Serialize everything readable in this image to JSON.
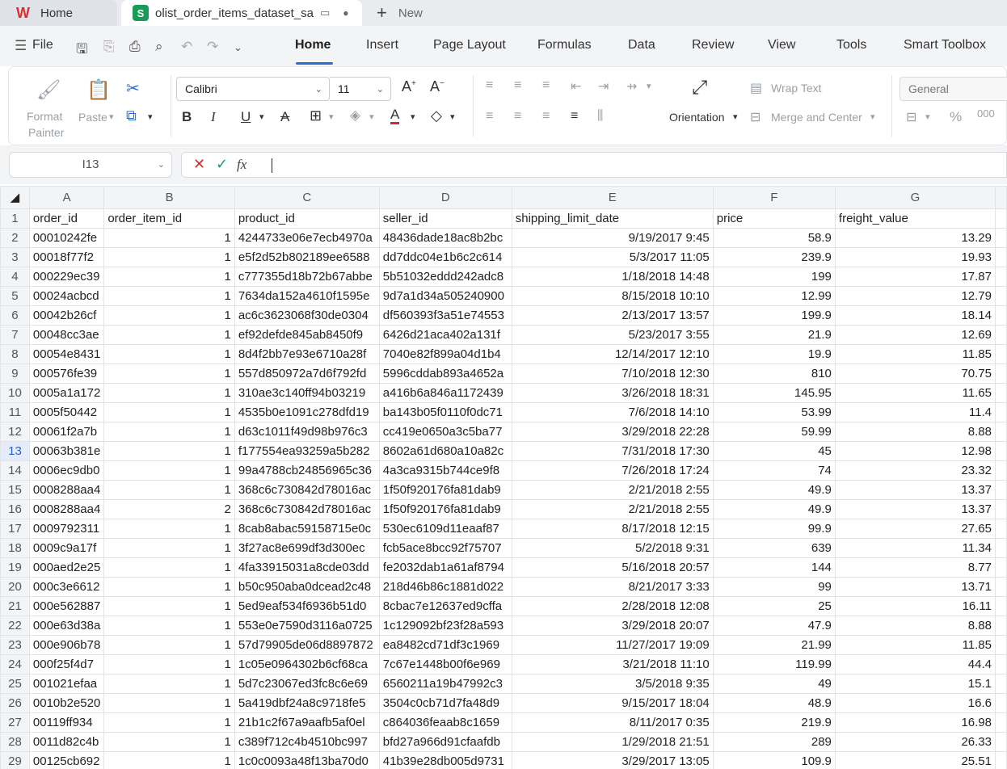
{
  "tabs": {
    "home_label": "Home",
    "file_title": "olist_order_items_dataset_sam",
    "new_label": "New"
  },
  "menu": {
    "file": "File",
    "items": [
      "Home",
      "Insert",
      "Page Layout",
      "Formulas",
      "Data",
      "Review",
      "View",
      "Tools",
      "Smart Toolbox"
    ]
  },
  "ribbon": {
    "format_painter_1": "Format",
    "format_painter_2": "Painter",
    "paste": "Paste",
    "font_name": "Calibri",
    "font_size": "11",
    "orientation": "Orientation",
    "wrap_text": "Wrap Text",
    "merge_center": "Merge and Center",
    "number_format": "General"
  },
  "formula_bar": {
    "name_box": "I13",
    "formula": ""
  },
  "sheet": {
    "columns": [
      "A",
      "B",
      "C",
      "D",
      "E",
      "F",
      "G"
    ],
    "selected_row": 13,
    "header_row": [
      "order_id",
      "order_item_id",
      "product_id",
      "seller_id",
      "shipping_limit_date",
      "price",
      "freight_value"
    ],
    "rows": [
      [
        "00010242fe",
        "1",
        "4244733e06e7ecb4970a",
        "48436dade18ac8b2bc",
        "9/19/2017 9:45",
        "58.9",
        "13.29"
      ],
      [
        "00018f77f2",
        "1",
        "e5f2d52b802189ee6588",
        "dd7ddc04e1b6c2c614",
        "5/3/2017 11:05",
        "239.9",
        "19.93"
      ],
      [
        "000229ec39",
        "1",
        "c777355d18b72b67abbe",
        "5b51032eddd242adc8",
        "1/18/2018 14:48",
        "199",
        "17.87"
      ],
      [
        "00024acbcd",
        "1",
        "7634da152a4610f1595e",
        "9d7a1d34a505240900",
        "8/15/2018 10:10",
        "12.99",
        "12.79"
      ],
      [
        "00042b26cf",
        "1",
        "ac6c3623068f30de0304",
        "df560393f3a51e74553",
        "2/13/2017 13:57",
        "199.9",
        "18.14"
      ],
      [
        "00048cc3ae",
        "1",
        "ef92defde845ab8450f9",
        "6426d21aca402a131f",
        "5/23/2017 3:55",
        "21.9",
        "12.69"
      ],
      [
        "00054e8431",
        "1",
        "8d4f2bb7e93e6710a28f",
        "7040e82f899a04d1b4",
        "12/14/2017 12:10",
        "19.9",
        "11.85"
      ],
      [
        "000576fe39",
        "1",
        "557d850972a7d6f792fd",
        "5996cddab893a4652a",
        "7/10/2018 12:30",
        "810",
        "70.75"
      ],
      [
        "0005a1a172",
        "1",
        "310ae3c140ff94b03219",
        "a416b6a846a1172439",
        "3/26/2018 18:31",
        "145.95",
        "11.65"
      ],
      [
        "0005f50442",
        "1",
        "4535b0e1091c278dfd19",
        "ba143b05f0110f0dc71",
        "7/6/2018 14:10",
        "53.99",
        "11.4"
      ],
      [
        "00061f2a7b",
        "1",
        "d63c1011f49d98b976c3",
        "cc419e0650a3c5ba77",
        "3/29/2018 22:28",
        "59.99",
        "8.88"
      ],
      [
        "00063b381e",
        "1",
        "f177554ea93259a5b282",
        "8602a61d680a10a82c",
        "7/31/2018 17:30",
        "45",
        "12.98"
      ],
      [
        "0006ec9db0",
        "1",
        "99a4788cb24856965c36",
        "4a3ca9315b744ce9f8",
        "7/26/2018 17:24",
        "74",
        "23.32"
      ],
      [
        "0008288aa4",
        "1",
        "368c6c730842d78016ac",
        "1f50f920176fa81dab9",
        "2/21/2018 2:55",
        "49.9",
        "13.37"
      ],
      [
        "0008288aa4",
        "2",
        "368c6c730842d78016ac",
        "1f50f920176fa81dab9",
        "2/21/2018 2:55",
        "49.9",
        "13.37"
      ],
      [
        "0009792311",
        "1",
        "8cab8abac59158715e0c",
        "530ec6109d11eaaf87",
        "8/17/2018 12:15",
        "99.9",
        "27.65"
      ],
      [
        "0009c9a17f",
        "1",
        "3f27ac8e699df3d300ec",
        "fcb5ace8bcc92f75707",
        "5/2/2018 9:31",
        "639",
        "11.34"
      ],
      [
        "000aed2e25",
        "1",
        "4fa33915031a8cde03dd",
        "fe2032dab1a61af8794",
        "5/16/2018 20:57",
        "144",
        "8.77"
      ],
      [
        "000c3e6612",
        "1",
        "b50c950aba0dcead2c48",
        "218d46b86c1881d022",
        "8/21/2017 3:33",
        "99",
        "13.71"
      ],
      [
        "000e562887",
        "1",
        "5ed9eaf534f6936b51d0",
        "8cbac7e12637ed9cffa",
        "2/28/2018 12:08",
        "25",
        "16.11"
      ],
      [
        "000e63d38a",
        "1",
        "553e0e7590d3116a0725",
        "1c129092bf23f28a593",
        "3/29/2018 20:07",
        "47.9",
        "8.88"
      ],
      [
        "000e906b78",
        "1",
        "57d79905de06d8897872",
        "ea8482cd71df3c1969",
        "11/27/2017 19:09",
        "21.99",
        "11.85"
      ],
      [
        "000f25f4d7",
        "1",
        "1c05e0964302b6cf68ca",
        "7c67e1448b00f6e969",
        "3/21/2018 11:10",
        "119.99",
        "44.4"
      ],
      [
        "001021efaa",
        "1",
        "5d7c23067ed3fc8c6e69",
        "6560211a19b47992c3",
        "3/5/2018 9:35",
        "49",
        "15.1"
      ],
      [
        "0010b2e520",
        "1",
        "5a419dbf24a8c9718fe5",
        "3504c0cb71d7fa48d9",
        "9/15/2017 18:04",
        "48.9",
        "16.6"
      ],
      [
        "00119ff934",
        "1",
        "21b1c2f67a9aafb5af0el",
        "c864036feaab8c1659",
        "8/11/2017 0:35",
        "219.9",
        "16.98"
      ],
      [
        "0011d82c4b",
        "1",
        "c389f712c4b4510bc997",
        "bfd27a966d91cfaafdb",
        "1/29/2018 21:51",
        "289",
        "26.33"
      ],
      [
        "00125cb692",
        "1",
        "1c0c0093a48f13ba70d0",
        "41b39e28db005d9731",
        "3/29/2017 13:05",
        "109.9",
        "25.51"
      ]
    ]
  }
}
